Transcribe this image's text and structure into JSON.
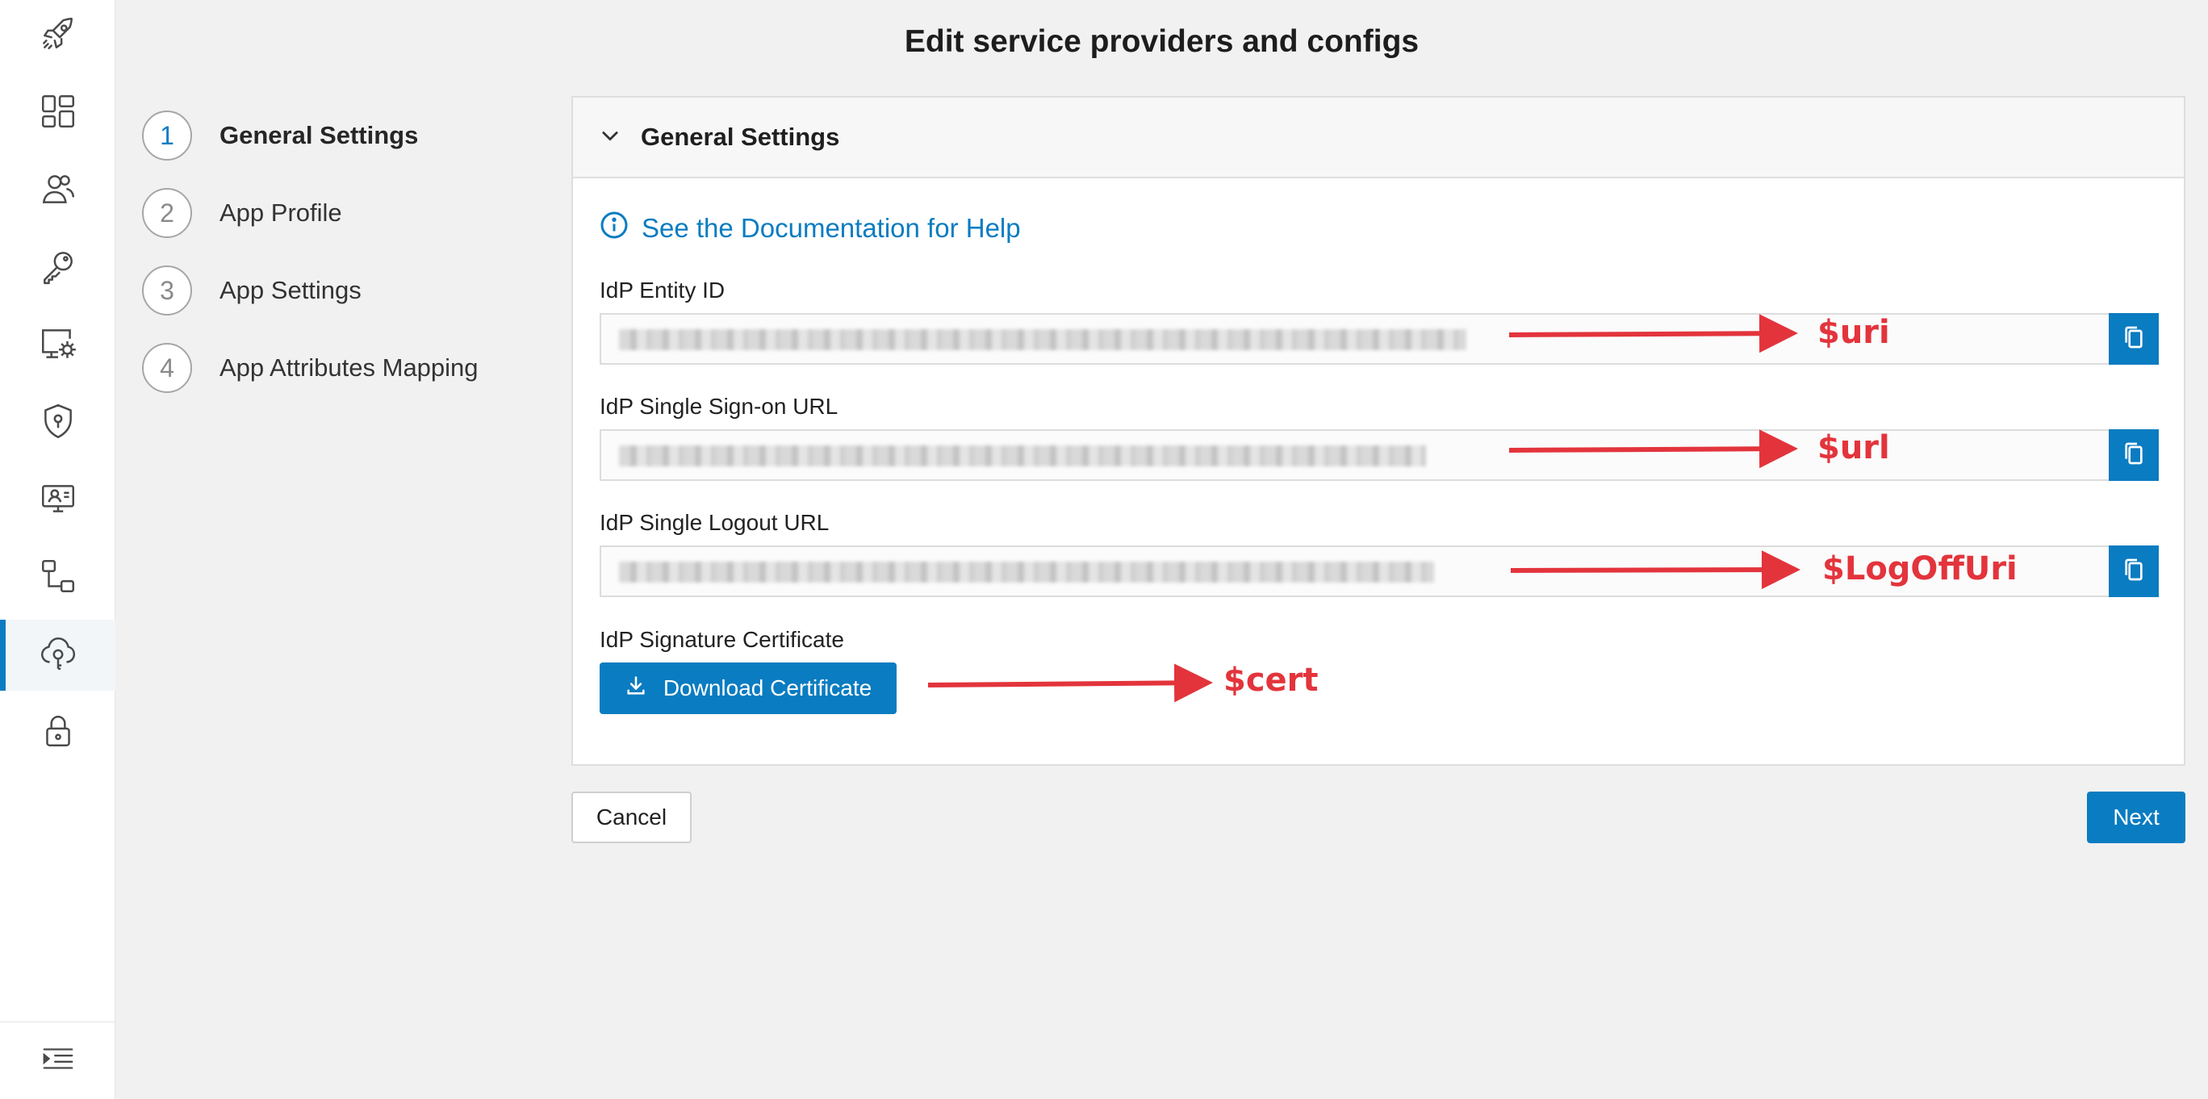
{
  "page": {
    "title": "Edit service providers and configs"
  },
  "rail": {
    "items": [
      {
        "icon": "rocket-icon"
      },
      {
        "icon": "dashboard-icon"
      },
      {
        "icon": "users-icon"
      },
      {
        "icon": "key-icon"
      },
      {
        "icon": "monitor-settings-icon"
      },
      {
        "icon": "shield-icon"
      },
      {
        "icon": "user-monitor-icon"
      },
      {
        "icon": "workflow-icon"
      },
      {
        "icon": "cloud-key-icon",
        "active": true
      },
      {
        "icon": "lock-icon"
      }
    ],
    "bottom_icon": "collapse-menu-icon"
  },
  "stepper": {
    "steps": [
      {
        "number": "1",
        "label": "General Settings",
        "active": true
      },
      {
        "number": "2",
        "label": "App Profile"
      },
      {
        "number": "3",
        "label": "App Settings"
      },
      {
        "number": "4",
        "label": "App Attributes Mapping"
      }
    ]
  },
  "panel": {
    "title": "General Settings",
    "help_link": "See the Documentation for Help",
    "fields": [
      {
        "label": "IdP Entity ID"
      },
      {
        "label": "IdP Single Sign-on URL"
      },
      {
        "label": "IdP Single Logout URL"
      }
    ],
    "certificate": {
      "label": "IdP Signature Certificate",
      "button": "Download Certificate"
    }
  },
  "footer": {
    "cancel": "Cancel",
    "next": "Next"
  },
  "annotations": {
    "color": "#e3343c",
    "labels": [
      "$uri",
      "$url",
      "$LogOffUri",
      "$cert"
    ]
  },
  "colors": {
    "accent": "#0a7cc1",
    "annotation": "#e3343c"
  }
}
